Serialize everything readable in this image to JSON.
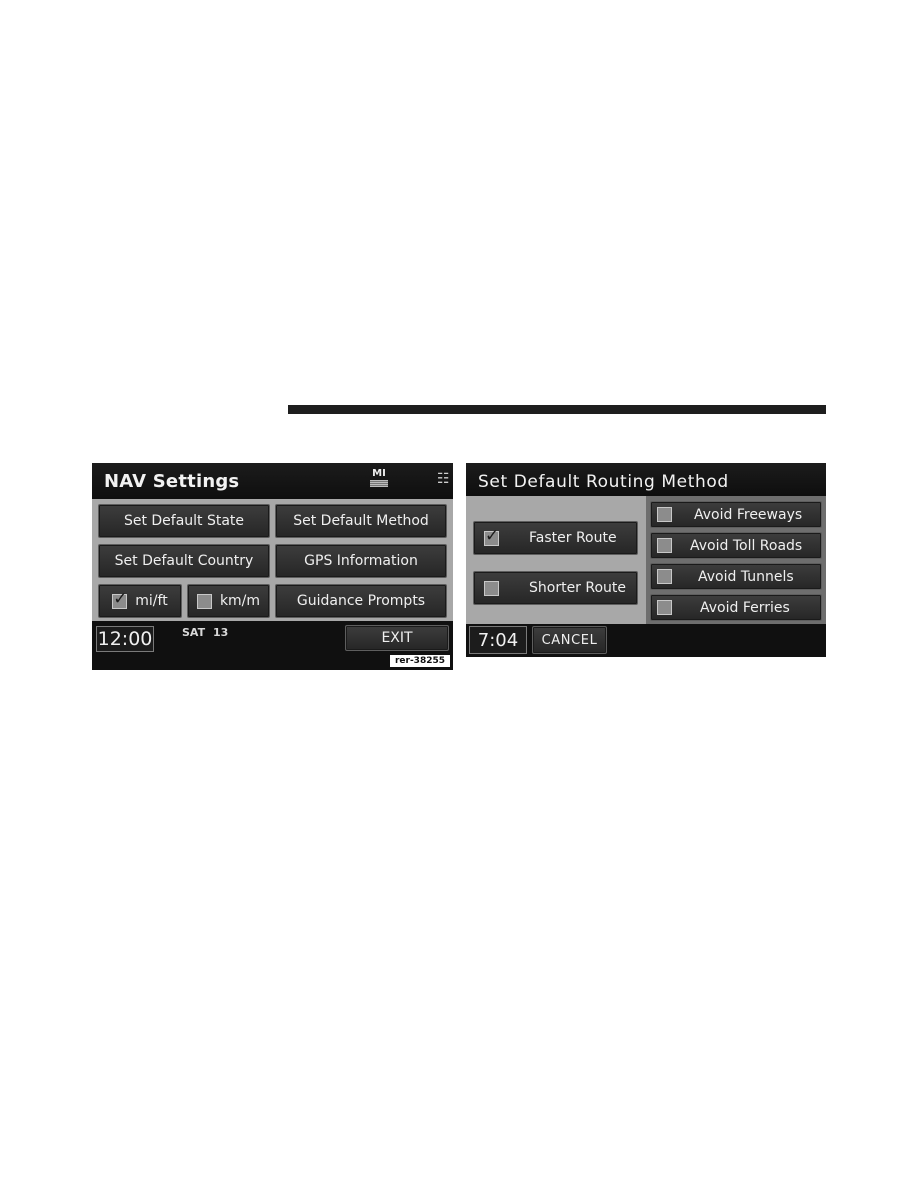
{
  "left_screen": {
    "title": "NAV Settings",
    "status_icons": {
      "map_label": "MI",
      "map_icon": "map-flag-icon",
      "seat_icon": "seat-icon"
    },
    "buttons": {
      "set_default_state": "Set Default State",
      "set_default_method": "Set Default Method",
      "set_default_country": "Set Default Country",
      "gps_information": "GPS Information",
      "mi_ft": "mi/ft",
      "km_m": "km/m",
      "guidance_prompts": "Guidance Prompts"
    },
    "units": {
      "mi_ft_checked": true,
      "km_m_checked": false
    },
    "clock": "12:00",
    "day": "SAT",
    "date": "13",
    "exit_label": "EXIT",
    "reference": "rer-38255"
  },
  "right_screen": {
    "title": "Set Default Routing Method",
    "route_options": [
      {
        "label": "Faster Route",
        "checked": true
      },
      {
        "label": "Shorter Route",
        "checked": false
      }
    ],
    "avoid_options": [
      {
        "label": "Avoid Freeways",
        "checked": false
      },
      {
        "label": "Avoid Toll Roads",
        "checked": false
      },
      {
        "label": "Avoid Tunnels",
        "checked": false
      },
      {
        "label": "Avoid Ferries",
        "checked": false
      }
    ],
    "clock": "7:04",
    "cancel_label": "CANCEL"
  }
}
